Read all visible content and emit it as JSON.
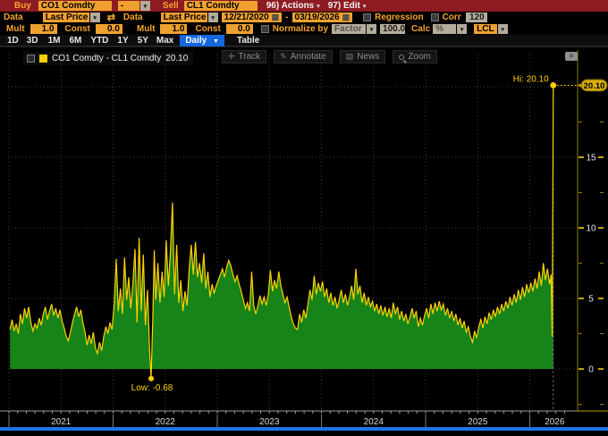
{
  "icons": {
    "dropdown_glyph": "▾",
    "swap_glyph": "⇄",
    "calendar_glyph": "▦",
    "menu_glyph": "≡",
    "track_glyph": "✛",
    "annotate_glyph": "✎",
    "news_glyph": "▤"
  },
  "toolbar": {
    "row1": {
      "buy_label": "Buy",
      "buy_value": "CO1 Comdty",
      "operator_value": "-",
      "sell_label": "Sell",
      "sell_value": "CL1 Comdty",
      "actions_label": "96) Actions",
      "edit_label": "97) Edit"
    },
    "row2": {
      "data1_label": "Data",
      "data1_value": "Last Price",
      "data2_label": "Data",
      "data2_value": "Last Price",
      "date_from": "12/21/2020",
      "date_sep": "-",
      "date_to": "03/19/2026",
      "regression_label": "Regression",
      "corr_label": "Corr",
      "corr_value": "120"
    },
    "row3": {
      "mult1_label": "Mult",
      "mult1_value": "1.0",
      "const1_label": "Const",
      "const1_value": "0.0",
      "mult2_label": "Mult",
      "mult2_value": "1.0",
      "const2_label": "Const",
      "const2_value": "0.0",
      "normalize_label": "Normalize by",
      "normalize_value": "Factor",
      "normalize_amount": "100.0",
      "calc_label": "Calc",
      "calc_value": "%",
      "feed_value": "LCL"
    },
    "row4": {
      "ranges": [
        "1D",
        "3D",
        "1M",
        "6M",
        "YTD",
        "1Y",
        "5Y",
        "Max"
      ],
      "period_value": "Daily",
      "period_caret": "▼",
      "table_label": "Table"
    }
  },
  "chart": {
    "legend": {
      "series_label": "CO1 Comdty - CL1 Comdty",
      "last_value": "20.10"
    },
    "tools": [
      {
        "icon": "crosshair-icon",
        "label": "Track"
      },
      {
        "icon": "pencil-icon",
        "label": "Annotate"
      },
      {
        "icon": "news-icon",
        "label": "News"
      },
      {
        "icon": "magnifier-icon",
        "label": "Zoom"
      }
    ],
    "hi_label": "Hi: 20.10",
    "hi_badge": "20.10",
    "low_label": "Low: -0.68",
    "colors": {
      "line": "#ffd100",
      "fill": "#168418",
      "badge": "#d9ae00",
      "grid": "#3c3c3c",
      "axis": "#8c7a00",
      "tick_text": "#e6e6e6",
      "year_text": "#d8d8d8"
    }
  },
  "chart_data": {
    "type": "area",
    "title": "CO1 Comdty - CL1 Comdty spread, Daily, 12/21/2020 - 03/19/2026",
    "xlim": [
      2020.9914,
      2026.476
    ],
    "ylim": [
      -2.72,
      22.28
    ],
    "y_ticks": [
      0,
      5,
      10,
      15
    ],
    "y_minor_ticks": [
      -2.5,
      2.5,
      7.5,
      12.5,
      17.5
    ],
    "y_gridlines": [
      0,
      5,
      10,
      15,
      20
    ],
    "x_year_labels": [
      "2021",
      "2022",
      "2023",
      "2024",
      "2025",
      "2026"
    ],
    "hi": {
      "t": 2026.225,
      "v": 20.1
    },
    "low": {
      "t": 2022.365,
      "v": -0.68
    },
    "points": [
      [
        2021.01,
        2.8
      ],
      [
        2021.03,
        3.5
      ],
      [
        2021.05,
        2.7
      ],
      [
        2021.07,
        3.2
      ],
      [
        2021.09,
        2.5
      ],
      [
        2021.11,
        3.9
      ],
      [
        2021.13,
        3.2
      ],
      [
        2021.15,
        4.3
      ],
      [
        2021.17,
        3.6
      ],
      [
        2021.19,
        4.4
      ],
      [
        2021.21,
        3.3
      ],
      [
        2021.23,
        2.7
      ],
      [
        2021.25,
        3.2
      ],
      [
        2021.27,
        2.9
      ],
      [
        2021.29,
        3.6
      ],
      [
        2021.31,
        3.1
      ],
      [
        2021.33,
        3.9
      ],
      [
        2021.35,
        4.4
      ],
      [
        2021.37,
        3.5
      ],
      [
        2021.39,
        4.1
      ],
      [
        2021.41,
        4.6
      ],
      [
        2021.43,
        3.8
      ],
      [
        2021.45,
        4.3
      ],
      [
        2021.47,
        3.6
      ],
      [
        2021.49,
        4.2
      ],
      [
        2021.51,
        3.4
      ],
      [
        2021.53,
        2.9
      ],
      [
        2021.55,
        2.3
      ],
      [
        2021.57,
        2.0
      ],
      [
        2021.59,
        2.6
      ],
      [
        2021.61,
        3.3
      ],
      [
        2021.63,
        3.9
      ],
      [
        2021.65,
        4.4
      ],
      [
        2021.67,
        3.7
      ],
      [
        2021.69,
        4.2
      ],
      [
        2021.71,
        3.3
      ],
      [
        2021.73,
        2.6
      ],
      [
        2021.75,
        1.7
      ],
      [
        2021.77,
        2.4
      ],
      [
        2021.79,
        1.8
      ],
      [
        2021.81,
        2.6
      ],
      [
        2021.83,
        1.5
      ],
      [
        2021.85,
        1.1
      ],
      [
        2021.87,
        1.9
      ],
      [
        2021.89,
        1.3
      ],
      [
        2021.91,
        2.3
      ],
      [
        2021.93,
        3.0
      ],
      [
        2021.95,
        2.5
      ],
      [
        2021.97,
        3.3
      ],
      [
        2021.99,
        2.8
      ],
      [
        2022.01,
        4.6
      ],
      [
        2022.03,
        7.8
      ],
      [
        2022.05,
        4.1
      ],
      [
        2022.07,
        5.7
      ],
      [
        2022.09,
        3.9
      ],
      [
        2022.11,
        7.9
      ],
      [
        2022.13,
        4.9
      ],
      [
        2022.15,
        6.5
      ],
      [
        2022.17,
        4.3
      ],
      [
        2022.19,
        6.0
      ],
      [
        2022.21,
        8.5
      ],
      [
        2022.23,
        3.3
      ],
      [
        2022.25,
        9.3
      ],
      [
        2022.27,
        4.1
      ],
      [
        2022.29,
        8.1
      ],
      [
        2022.31,
        3.1
      ],
      [
        2022.33,
        5.6
      ],
      [
        2022.35,
        1.4
      ],
      [
        2022.365,
        -0.68
      ],
      [
        2022.38,
        3.4
      ],
      [
        2022.395,
        8.4
      ],
      [
        2022.41,
        4.9
      ],
      [
        2022.43,
        7.5
      ],
      [
        2022.45,
        4.7
      ],
      [
        2022.47,
        6.9
      ],
      [
        2022.49,
        5.1
      ],
      [
        2022.51,
        9.1
      ],
      [
        2022.53,
        5.9
      ],
      [
        2022.55,
        8.3
      ],
      [
        2022.57,
        11.8
      ],
      [
        2022.59,
        5.3
      ],
      [
        2022.61,
        8.8
      ],
      [
        2022.63,
        4.7
      ],
      [
        2022.65,
        6.3
      ],
      [
        2022.67,
        4.1
      ],
      [
        2022.69,
        5.5
      ],
      [
        2022.71,
        4.5
      ],
      [
        2022.73,
        7.1
      ],
      [
        2022.75,
        8.8
      ],
      [
        2022.77,
        6.7
      ],
      [
        2022.79,
        9.0
      ],
      [
        2022.81,
        6.5
      ],
      [
        2022.83,
        7.5
      ],
      [
        2022.85,
        6.1
      ],
      [
        2022.87,
        8.2
      ],
      [
        2022.89,
        5.7
      ],
      [
        2022.91,
        6.9
      ],
      [
        2022.93,
        5.1
      ],
      [
        2022.95,
        6.0
      ],
      [
        2022.97,
        5.4
      ],
      [
        2022.99,
        5.9
      ],
      [
        2023.01,
        6.3
      ],
      [
        2023.03,
        6.7
      ],
      [
        2023.05,
        7.1
      ],
      [
        2023.07,
        6.5
      ],
      [
        2023.09,
        7.2
      ],
      [
        2023.11,
        7.7
      ],
      [
        2023.13,
        7.3
      ],
      [
        2023.15,
        6.7
      ],
      [
        2023.17,
        6.2
      ],
      [
        2023.19,
        6.6
      ],
      [
        2023.21,
        6.0
      ],
      [
        2023.23,
        5.5
      ],
      [
        2023.25,
        4.9
      ],
      [
        2023.27,
        4.3
      ],
      [
        2023.29,
        4.7
      ],
      [
        2023.31,
        4.1
      ],
      [
        2023.33,
        6.9
      ],
      [
        2023.35,
        4.5
      ],
      [
        2023.37,
        3.9
      ],
      [
        2023.39,
        4.5
      ],
      [
        2023.41,
        5.2
      ],
      [
        2023.43,
        4.6
      ],
      [
        2023.45,
        5.1
      ],
      [
        2023.47,
        4.5
      ],
      [
        2023.49,
        5.3
      ],
      [
        2023.51,
        7.0
      ],
      [
        2023.53,
        5.5
      ],
      [
        2023.55,
        6.3
      ],
      [
        2023.57,
        5.7
      ],
      [
        2023.59,
        6.9
      ],
      [
        2023.61,
        5.9
      ],
      [
        2023.63,
        5.3
      ],
      [
        2023.65,
        4.7
      ],
      [
        2023.67,
        5.1
      ],
      [
        2023.69,
        4.4
      ],
      [
        2023.71,
        3.7
      ],
      [
        2023.73,
        3.2
      ],
      [
        2023.75,
        2.9
      ],
      [
        2023.77,
        2.8
      ],
      [
        2023.79,
        3.9
      ],
      [
        2023.81,
        3.3
      ],
      [
        2023.83,
        4.2
      ],
      [
        2023.85,
        3.6
      ],
      [
        2023.87,
        4.6
      ],
      [
        2023.89,
        5.6
      ],
      [
        2023.91,
        4.9
      ],
      [
        2023.93,
        6.6
      ],
      [
        2023.95,
        5.3
      ],
      [
        2023.97,
        6.1
      ],
      [
        2023.99,
        5.5
      ],
      [
        2024.01,
        6.2
      ],
      [
        2024.03,
        5.1
      ],
      [
        2024.05,
        5.7
      ],
      [
        2024.07,
        4.7
      ],
      [
        2024.09,
        5.4
      ],
      [
        2024.11,
        4.5
      ],
      [
        2024.13,
        5.1
      ],
      [
        2024.15,
        4.3
      ],
      [
        2024.17,
        4.9
      ],
      [
        2024.19,
        5.6
      ],
      [
        2024.21,
        4.7
      ],
      [
        2024.23,
        5.3
      ],
      [
        2024.25,
        4.5
      ],
      [
        2024.27,
        5.1
      ],
      [
        2024.29,
        5.9
      ],
      [
        2024.31,
        4.9
      ],
      [
        2024.33,
        7.1
      ],
      [
        2024.35,
        5.3
      ],
      [
        2024.37,
        5.9
      ],
      [
        2024.39,
        4.7
      ],
      [
        2024.41,
        5.4
      ],
      [
        2024.43,
        4.5
      ],
      [
        2024.45,
        5.1
      ],
      [
        2024.47,
        4.4
      ],
      [
        2024.49,
        4.8
      ],
      [
        2024.51,
        4.1
      ],
      [
        2024.53,
        4.6
      ],
      [
        2024.55,
        3.9
      ],
      [
        2024.57,
        4.5
      ],
      [
        2024.59,
        3.8
      ],
      [
        2024.61,
        4.4
      ],
      [
        2024.63,
        3.7
      ],
      [
        2024.65,
        4.3
      ],
      [
        2024.67,
        3.6
      ],
      [
        2024.69,
        4.7
      ],
      [
        2024.71,
        3.9
      ],
      [
        2024.73,
        4.4
      ],
      [
        2024.75,
        3.5
      ],
      [
        2024.77,
        4.1
      ],
      [
        2024.79,
        3.4
      ],
      [
        2024.81,
        3.9
      ],
      [
        2024.83,
        3.2
      ],
      [
        2024.85,
        3.7
      ],
      [
        2024.87,
        4.3
      ],
      [
        2024.89,
        3.6
      ],
      [
        2024.91,
        4.1
      ],
      [
        2024.93,
        3.0
      ],
      [
        2024.95,
        3.6
      ],
      [
        2024.97,
        3.1
      ],
      [
        2024.99,
        3.8
      ],
      [
        2025.01,
        4.3
      ],
      [
        2025.03,
        3.6
      ],
      [
        2025.05,
        4.6
      ],
      [
        2025.07,
        3.9
      ],
      [
        2025.09,
        4.7
      ],
      [
        2025.11,
        4.1
      ],
      [
        2025.13,
        4.8
      ],
      [
        2025.15,
        4.2
      ],
      [
        2025.17,
        4.6
      ],
      [
        2025.19,
        3.8
      ],
      [
        2025.21,
        4.3
      ],
      [
        2025.23,
        3.6
      ],
      [
        2025.25,
        4.1
      ],
      [
        2025.27,
        3.4
      ],
      [
        2025.29,
        3.9
      ],
      [
        2025.31,
        3.1
      ],
      [
        2025.33,
        3.6
      ],
      [
        2025.35,
        2.9
      ],
      [
        2025.37,
        3.4
      ],
      [
        2025.39,
        2.6
      ],
      [
        2025.41,
        3.0
      ],
      [
        2025.43,
        2.3
      ],
      [
        2025.45,
        1.9
      ],
      [
        2025.47,
        2.7
      ],
      [
        2025.49,
        2.2
      ],
      [
        2025.51,
        3.0
      ],
      [
        2025.53,
        3.5
      ],
      [
        2025.55,
        2.9
      ],
      [
        2025.57,
        3.7
      ],
      [
        2025.59,
        3.2
      ],
      [
        2025.61,
        4.0
      ],
      [
        2025.63,
        3.5
      ],
      [
        2025.65,
        4.2
      ],
      [
        2025.67,
        3.7
      ],
      [
        2025.69,
        4.4
      ],
      [
        2025.71,
        3.9
      ],
      [
        2025.73,
        4.6
      ],
      [
        2025.75,
        4.1
      ],
      [
        2025.77,
        4.8
      ],
      [
        2025.79,
        4.3
      ],
      [
        2025.81,
        5.1
      ],
      [
        2025.83,
        4.5
      ],
      [
        2025.85,
        5.3
      ],
      [
        2025.87,
        4.7
      ],
      [
        2025.89,
        5.6
      ],
      [
        2025.91,
        4.9
      ],
      [
        2025.93,
        5.8
      ],
      [
        2025.95,
        5.1
      ],
      [
        2025.97,
        6.0
      ],
      [
        2025.99,
        5.4
      ],
      [
        2026.01,
        6.1
      ],
      [
        2026.03,
        5.5
      ],
      [
        2026.05,
        6.4
      ],
      [
        2026.07,
        5.7
      ],
      [
        2026.09,
        6.9
      ],
      [
        2026.11,
        5.9
      ],
      [
        2026.13,
        7.5
      ],
      [
        2026.15,
        6.3
      ],
      [
        2026.17,
        7.1
      ],
      [
        2026.19,
        6.0
      ],
      [
        2026.205,
        6.7
      ],
      [
        2026.215,
        2.3
      ],
      [
        2026.225,
        20.1
      ]
    ]
  }
}
